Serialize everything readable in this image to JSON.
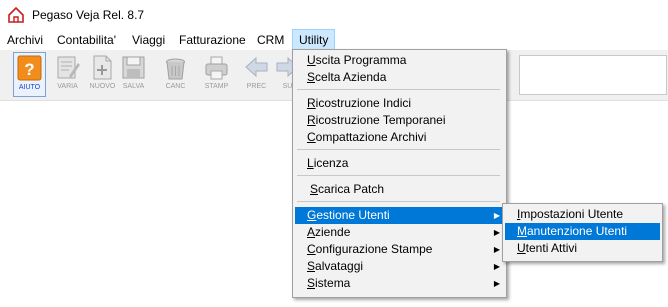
{
  "app": {
    "title": "Pegaso Veja   Rel. 8.7"
  },
  "menubar": [
    "Archivi",
    "Contabilita'",
    "Viaggi",
    "Fatturazione",
    "CRM",
    "Utility"
  ],
  "toolbar": [
    {
      "label": "AIUTO",
      "icon": "help-icon"
    },
    {
      "label": "VARIA",
      "icon": "edit-icon"
    },
    {
      "label": "NUOVO",
      "icon": "new-document-icon"
    },
    {
      "label": "SALVA",
      "icon": "save-icon"
    },
    {
      "label": "CANC",
      "icon": "delete-icon"
    },
    {
      "label": "STAMP",
      "icon": "print-icon"
    },
    {
      "label": "PREC",
      "icon": "arrow-left-icon"
    },
    {
      "label": "SU",
      "icon": "arrow-right-icon"
    }
  ],
  "utility_menu": [
    {
      "label": "Uscita Programma",
      "u": 0
    },
    {
      "label": "Scelta Azienda",
      "u": 0
    },
    {
      "label": "Ricostruzione Indici",
      "u": 0
    },
    {
      "label": "Ricostruzione Temporanei",
      "u": 0
    },
    {
      "label": "Compattazione Archivi",
      "u": 0
    },
    {
      "label": "Licenza",
      "u": 0
    },
    {
      "label": "Scarica Patch",
      "u": 0
    },
    {
      "label": "Gestione Utenti",
      "u": 0,
      "submenu": true
    },
    {
      "label": "Aziende",
      "u": 0,
      "submenu": true
    },
    {
      "label": "Configurazione Stampe",
      "u": 0,
      "submenu": true
    },
    {
      "label": "Salvataggi",
      "u": 0,
      "submenu": true
    },
    {
      "label": "Sistema",
      "u": 0,
      "submenu": true
    }
  ],
  "gestione_utenti_submenu": [
    {
      "label": "Impostazioni Utente",
      "u": 0
    },
    {
      "label": "Manutenzione Utenti",
      "u": 0
    },
    {
      "label": "Utenti Attivi",
      "u": 0
    }
  ],
  "colors": {
    "highlight": "#0078d7",
    "menubar_open": "#cce8ff",
    "help_orange": "#f28c1b"
  }
}
